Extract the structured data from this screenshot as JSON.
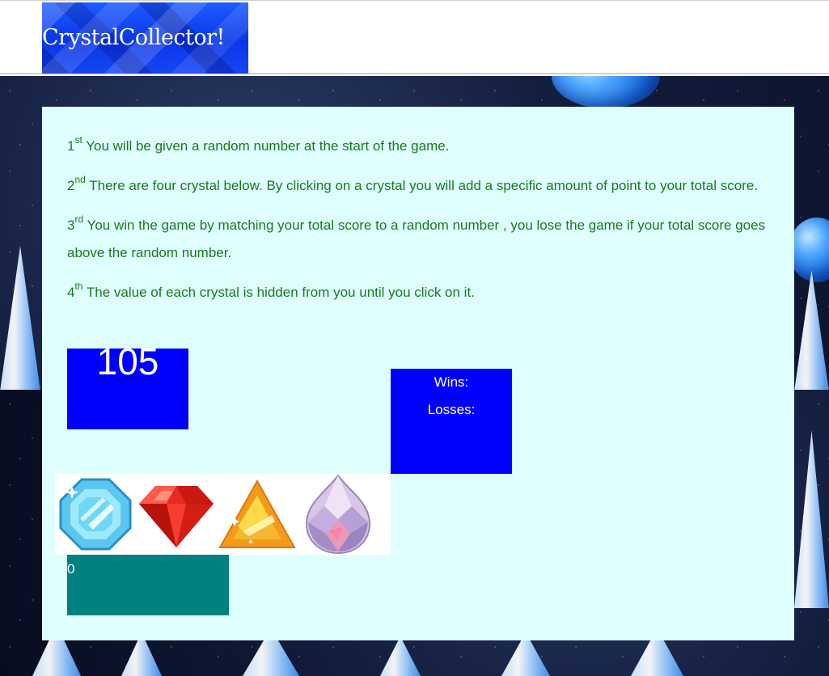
{
  "header": {
    "logo_text": "CrystalCollector!"
  },
  "instructions": [
    {
      "ordinal": "1",
      "suffix": "st",
      "text": " You will be given a random number at the start of the game."
    },
    {
      "ordinal": "2",
      "suffix": "nd",
      "text": " There are four crystal below. By clicking on a crystal you will add a specific amount of point to your total score."
    },
    {
      "ordinal": "3",
      "suffix": "rd",
      "text": " You win the game by matching your total score to a random number , you lose the game if your total score goes above the random number."
    },
    {
      "ordinal": "4",
      "suffix": "th",
      "text": " The value of each crystal is hidden from you until you click on it."
    }
  ],
  "game": {
    "target_number": "105",
    "wins_label": "Wins:",
    "losses_label": "Losses:",
    "total_score": "0"
  },
  "crystals": [
    {
      "icon": "blue-octagon-crystal-icon"
    },
    {
      "icon": "red-ruby-crystal-icon"
    },
    {
      "icon": "orange-triangle-crystal-icon"
    },
    {
      "icon": "pink-teardrop-crystal-icon"
    }
  ],
  "colors": {
    "panel_bg": "#dfffff",
    "text_green": "#1a7a1a",
    "box_blue": "#0000ff",
    "total_teal": "#008080"
  }
}
